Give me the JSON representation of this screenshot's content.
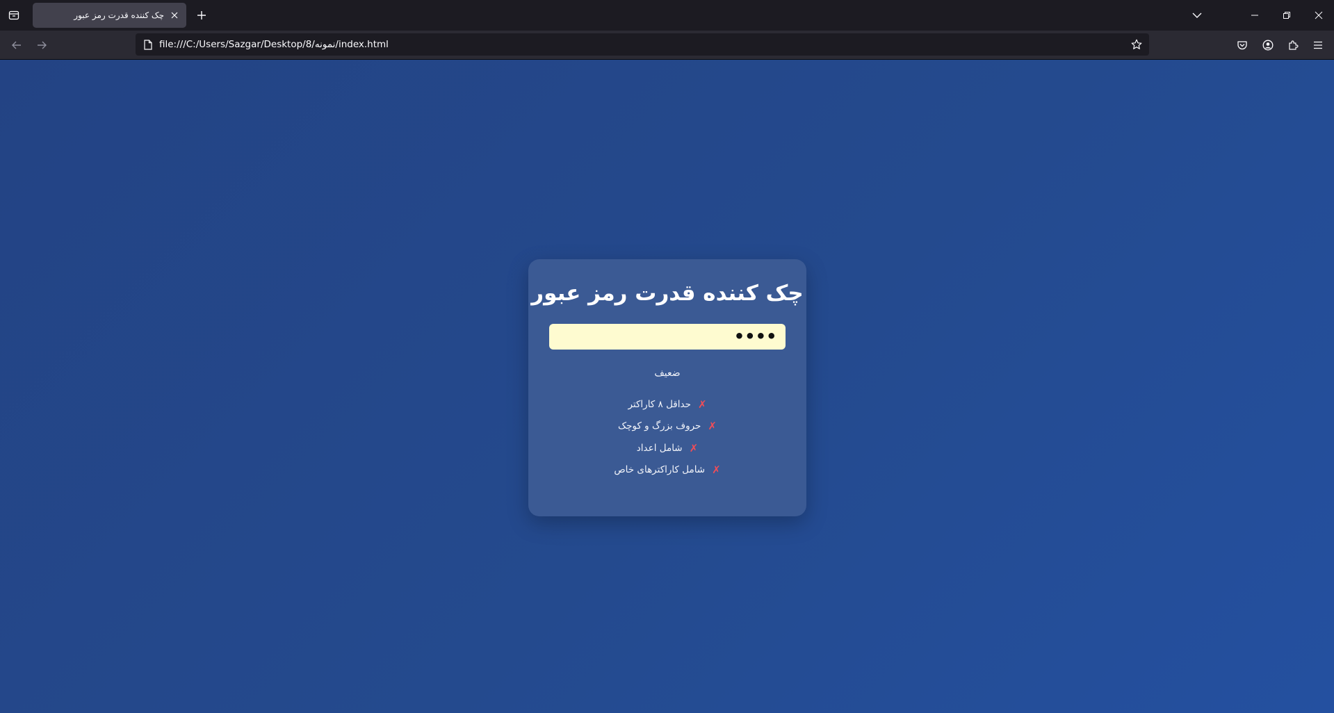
{
  "browser": {
    "tab": {
      "title": "چک کننده قدرت رمز عبور"
    },
    "url": "file:///C:/Users/Sazgar/Desktop/8/نمونه/index.html"
  },
  "page": {
    "title": "چک کننده قدرت رمز عبور",
    "password": {
      "value": "••••",
      "type": "password"
    },
    "strength_label": "ضعیف",
    "requirements": [
      {
        "label": "حداقل ۸ کاراکتر",
        "status": "✗"
      },
      {
        "label": "حروف بزرگ و کوچک",
        "status": "✗"
      },
      {
        "label": "شامل اعداد",
        "status": "✗"
      },
      {
        "label": "شامل کاراکترهای خاص",
        "status": "✗"
      }
    ]
  },
  "colors": {
    "page_background": "#234384",
    "card_background": "#3b5a94",
    "input_background": "#fefbd0",
    "fail_mark": "#f24d57"
  }
}
